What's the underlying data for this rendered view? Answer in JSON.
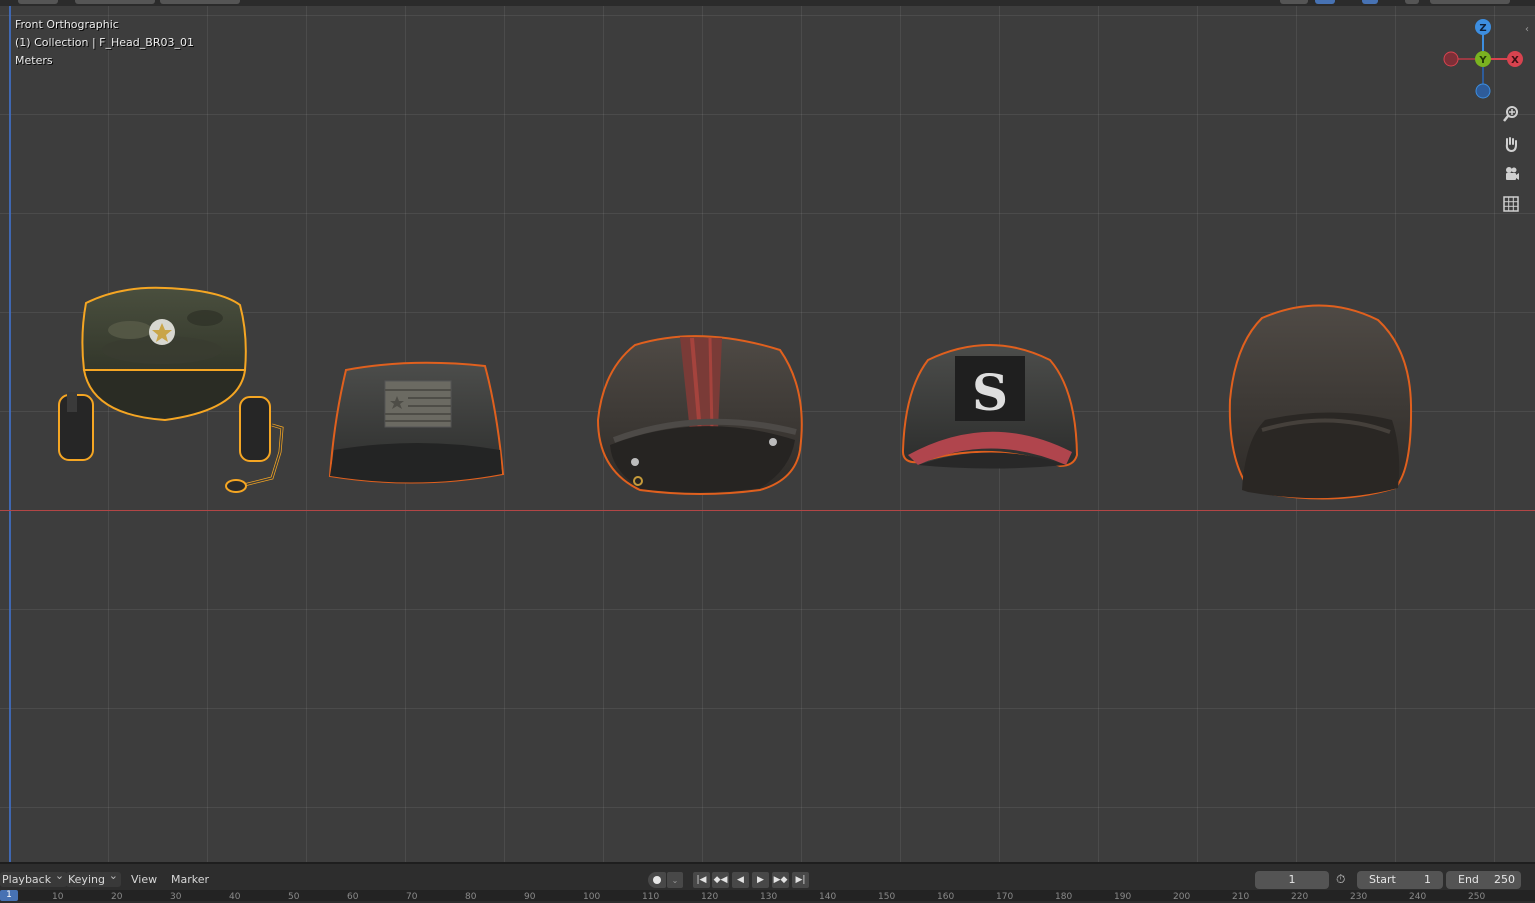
{
  "viewport": {
    "view_name": "Front Orthographic",
    "collection": "(1) Collection | F_Head_BR03_01",
    "units": "Meters",
    "objects": [
      {
        "name": "military-cap-with-headset"
      },
      {
        "name": "flag-patrol-cap"
      },
      {
        "name": "striped-flat-cap"
      },
      {
        "name": "s-logo-baseball-cap"
      },
      {
        "name": "beanie"
      }
    ],
    "selection_outline_active": "#f5a623",
    "selection_outline": "#e0601e"
  },
  "gizmo": {
    "z_label": "Z",
    "y_label": "Y",
    "x_label": "X",
    "x_color": "#d8434f",
    "y_color": "#7ab320",
    "z_color": "#3d8ee0"
  },
  "nav_tools": [
    "zoom-icon",
    "hand-pan-icon",
    "camera-icon",
    "grid-icon"
  ],
  "timeline": {
    "menus": {
      "playback": "Playback",
      "keying": "Keying",
      "view": "View",
      "marker": "Marker"
    },
    "current_frame": "1",
    "start_label": "Start",
    "start_value": "1",
    "end_label": "End",
    "end_value": "250"
  },
  "ruler": {
    "ticks": [
      "10",
      "20",
      "30",
      "40",
      "50",
      "60",
      "70",
      "80",
      "90",
      "100",
      "110",
      "120",
      "130",
      "140",
      "150",
      "160",
      "170",
      "180",
      "190",
      "200",
      "210",
      "220",
      "230",
      "240",
      "250"
    ],
    "playhead": "1"
  },
  "colors": {
    "viewport_bg": "#3d3d3d",
    "timeline_bg": "#2d2d2d",
    "accent": "#4772b3"
  }
}
